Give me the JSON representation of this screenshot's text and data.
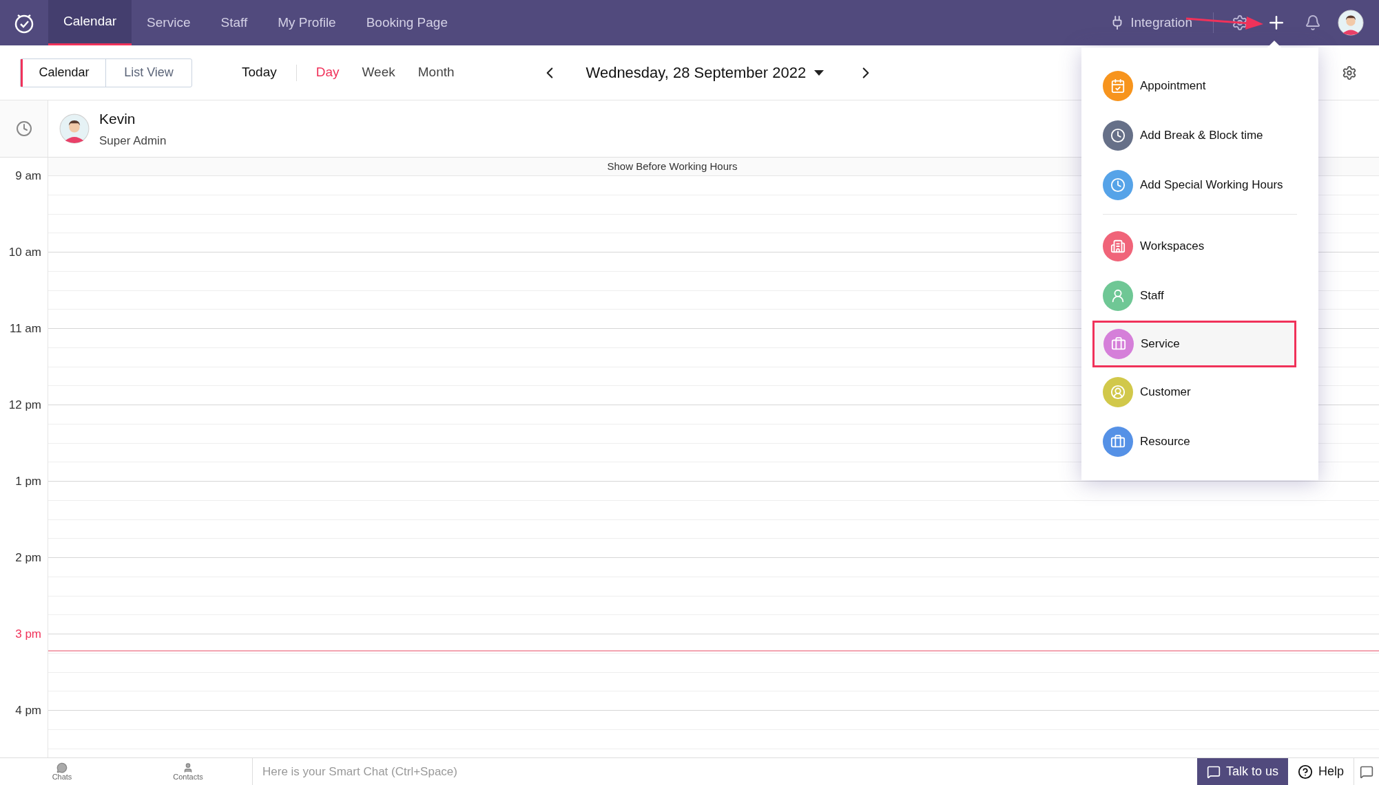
{
  "nav": {
    "tabs": [
      {
        "label": "Calendar",
        "selected": true
      },
      {
        "label": "Service",
        "selected": false
      },
      {
        "label": "Staff",
        "selected": false
      },
      {
        "label": "My Profile",
        "selected": false
      },
      {
        "label": "Booking Page",
        "selected": false
      }
    ],
    "integration": "Integration"
  },
  "toolbar": {
    "view_toggle": [
      {
        "label": "Calendar",
        "selected": true
      },
      {
        "label": "List View",
        "selected": false
      }
    ],
    "today": "Today",
    "ranges": [
      {
        "label": "Day",
        "selected": true
      },
      {
        "label": "Week",
        "selected": false
      },
      {
        "label": "Month",
        "selected": false
      }
    ],
    "date": "Wednesday, 28 September 2022"
  },
  "staff": {
    "name": "Kevin",
    "role": "Super Admin"
  },
  "calendar": {
    "show_before": "Show Before Working Hours",
    "hours": [
      {
        "label": "9 am",
        "current": false
      },
      {
        "label": "10 am",
        "current": false
      },
      {
        "label": "11 am",
        "current": false
      },
      {
        "label": "12 pm",
        "current": false
      },
      {
        "label": "1 pm",
        "current": false
      },
      {
        "label": "2 pm",
        "current": false
      },
      {
        "label": "3 pm",
        "current": true
      },
      {
        "label": "4 pm",
        "current": false
      }
    ]
  },
  "add_menu": {
    "groups": [
      [
        {
          "label": "Appointment",
          "color": "#f7941d",
          "selected": false
        },
        {
          "label": "Add Break & Block time",
          "color": "#667088",
          "selected": false
        },
        {
          "label": "Add Special Working Hours",
          "color": "#56a3e8",
          "selected": false
        }
      ],
      [
        {
          "label": "Workspaces",
          "color": "#f06479",
          "selected": false
        },
        {
          "label": "Staff",
          "color": "#6fc795",
          "selected": false
        },
        {
          "label": "Service",
          "color": "#d57fd9",
          "selected": true
        },
        {
          "label": "Customer",
          "color": "#d1c84a",
          "selected": false
        },
        {
          "label": "Resource",
          "color": "#5591e6",
          "selected": false
        }
      ]
    ]
  },
  "bottom_bar": {
    "chats": "Chats",
    "contacts": "Contacts",
    "chat_placeholder": "Here is your Smart Chat (Ctrl+Space)",
    "talk": "Talk to us",
    "help": "Help"
  }
}
